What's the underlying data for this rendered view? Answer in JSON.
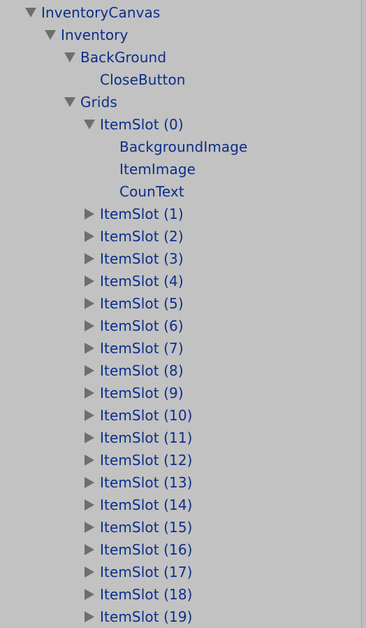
{
  "hierarchy": {
    "items": [
      {
        "label": "InventoryCanvas",
        "depth": 0,
        "state": "expanded",
        "name": "tree-item-inventory-canvas"
      },
      {
        "label": "Inventory",
        "depth": 1,
        "state": "expanded",
        "name": "tree-item-inventory"
      },
      {
        "label": "BackGround",
        "depth": 2,
        "state": "expanded",
        "name": "tree-item-background"
      },
      {
        "label": "CloseButton",
        "depth": 3,
        "state": "leaf",
        "name": "tree-item-close-button"
      },
      {
        "label": "Grids",
        "depth": 2,
        "state": "expanded",
        "name": "tree-item-grids"
      },
      {
        "label": "ItemSlot (0)",
        "depth": 3,
        "state": "expanded",
        "name": "tree-item-itemslot-0"
      },
      {
        "label": "BackgroundImage",
        "depth": 4,
        "state": "leaf",
        "name": "tree-item-background-image"
      },
      {
        "label": "ItemImage",
        "depth": 4,
        "state": "leaf",
        "name": "tree-item-item-image"
      },
      {
        "label": "CounText",
        "depth": 4,
        "state": "leaf",
        "name": "tree-item-coun-text"
      },
      {
        "label": "ItemSlot (1)",
        "depth": 3,
        "state": "collapsed",
        "name": "tree-item-itemslot-1"
      },
      {
        "label": "ItemSlot (2)",
        "depth": 3,
        "state": "collapsed",
        "name": "tree-item-itemslot-2"
      },
      {
        "label": "ItemSlot (3)",
        "depth": 3,
        "state": "collapsed",
        "name": "tree-item-itemslot-3"
      },
      {
        "label": "ItemSlot (4)",
        "depth": 3,
        "state": "collapsed",
        "name": "tree-item-itemslot-4"
      },
      {
        "label": "ItemSlot (5)",
        "depth": 3,
        "state": "collapsed",
        "name": "tree-item-itemslot-5"
      },
      {
        "label": "ItemSlot (6)",
        "depth": 3,
        "state": "collapsed",
        "name": "tree-item-itemslot-6"
      },
      {
        "label": "ItemSlot (7)",
        "depth": 3,
        "state": "collapsed",
        "name": "tree-item-itemslot-7"
      },
      {
        "label": "ItemSlot (8)",
        "depth": 3,
        "state": "collapsed",
        "name": "tree-item-itemslot-8"
      },
      {
        "label": "ItemSlot (9)",
        "depth": 3,
        "state": "collapsed",
        "name": "tree-item-itemslot-9"
      },
      {
        "label": "ItemSlot (10)",
        "depth": 3,
        "state": "collapsed",
        "name": "tree-item-itemslot-10"
      },
      {
        "label": "ItemSlot (11)",
        "depth": 3,
        "state": "collapsed",
        "name": "tree-item-itemslot-11"
      },
      {
        "label": "ItemSlot (12)",
        "depth": 3,
        "state": "collapsed",
        "name": "tree-item-itemslot-12"
      },
      {
        "label": "ItemSlot (13)",
        "depth": 3,
        "state": "collapsed",
        "name": "tree-item-itemslot-13"
      },
      {
        "label": "ItemSlot (14)",
        "depth": 3,
        "state": "collapsed",
        "name": "tree-item-itemslot-14"
      },
      {
        "label": "ItemSlot (15)",
        "depth": 3,
        "state": "collapsed",
        "name": "tree-item-itemslot-15"
      },
      {
        "label": "ItemSlot (16)",
        "depth": 3,
        "state": "collapsed",
        "name": "tree-item-itemslot-16"
      },
      {
        "label": "ItemSlot (17)",
        "depth": 3,
        "state": "collapsed",
        "name": "tree-item-itemslot-17"
      },
      {
        "label": "ItemSlot (18)",
        "depth": 3,
        "state": "collapsed",
        "name": "tree-item-itemslot-18"
      },
      {
        "label": "ItemSlot (19)",
        "depth": 3,
        "state": "collapsed",
        "name": "tree-item-itemslot-19"
      }
    ]
  },
  "colors": {
    "background": "#c2c2c2",
    "label_text": "#0b2e8a",
    "arrow": "#6e6e6e"
  },
  "icons": {
    "expanded": "triangle-down-icon",
    "collapsed": "triangle-right-icon"
  }
}
